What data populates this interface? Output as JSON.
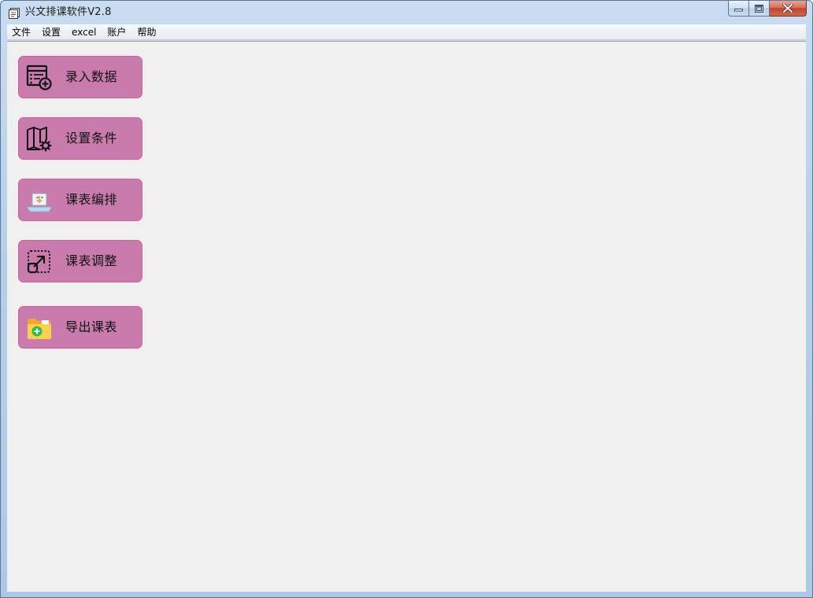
{
  "window": {
    "title": "兴文排课软件V2.8"
  },
  "menu": {
    "items": [
      "文件",
      "设置",
      "excel",
      "账户",
      "帮助"
    ]
  },
  "nav": {
    "buttons": [
      {
        "label": "录入数据",
        "icon": "list-add-icon"
      },
      {
        "label": "设置条件",
        "icon": "map-settings-icon"
      },
      {
        "label": "课表编排",
        "icon": "laptop-download-icon"
      },
      {
        "label": "课表调整",
        "icon": "resize-arrow-icon"
      },
      {
        "label": "导出课表",
        "icon": "folder-add-icon"
      }
    ]
  },
  "colors": {
    "button_fill": "#c97bad",
    "button_border": "#d95f8a",
    "client_bg": "#f0f0f0",
    "close_button": "#c3432a"
  }
}
